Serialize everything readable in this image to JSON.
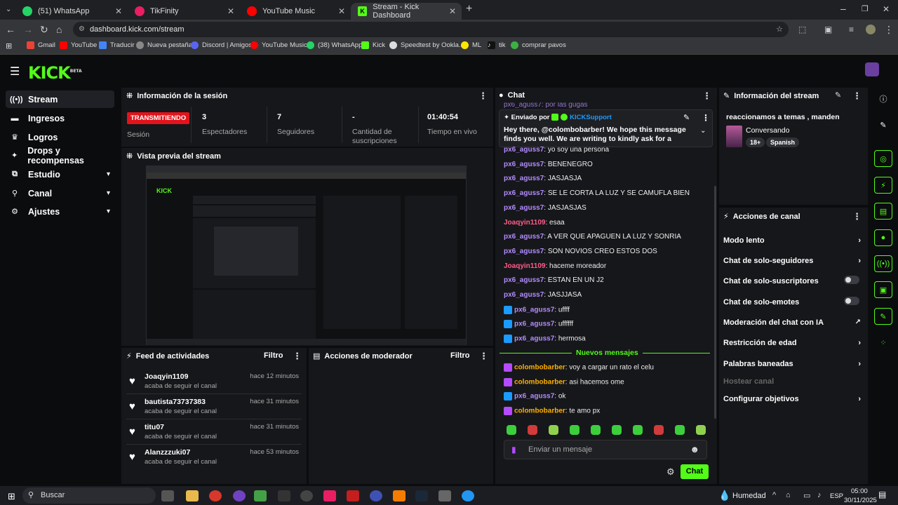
{
  "browser": {
    "tabs": [
      {
        "label": "(51) WhatsApp",
        "color": "#25d366"
      },
      {
        "label": "TikFinity",
        "color": "#e91e63"
      },
      {
        "label": "YouTube Music",
        "color": "#ff0000"
      },
      {
        "label": "Stream - Kick Dashboard",
        "color": "#53fc18"
      }
    ],
    "url": "dashboard.kick.com/stream",
    "bookmarks": [
      {
        "label": "Gmail",
        "color": "#ea4335"
      },
      {
        "label": "YouTube",
        "color": "#ff0000"
      },
      {
        "label": "Traducir",
        "color": "#4285f4"
      },
      {
        "label": "Nueva pestaña",
        "color": "#888"
      },
      {
        "label": "Discord | Amigos",
        "color": "#5865f2"
      },
      {
        "label": "YouTube Music",
        "color": "#ff0000"
      },
      {
        "label": "(38) WhatsApp",
        "color": "#25d366"
      },
      {
        "label": "Kick",
        "color": "#53fc18"
      },
      {
        "label": "Speedtest by Ookla...",
        "color": "#ddd"
      },
      {
        "label": "ML",
        "color": "#ffe600"
      },
      {
        "label": "tik",
        "color": "#fff"
      },
      {
        "label": "comprar pavos",
        "color": "#3cb043"
      }
    ]
  },
  "kick": {
    "logo": "KICK",
    "logo_sup": "BETA",
    "sidebar": [
      {
        "label": "Stream",
        "icon": "broadcast-icon",
        "chev": ""
      },
      {
        "label": "Ingresos",
        "icon": "money-icon",
        "chev": ""
      },
      {
        "label": "Logros",
        "icon": "trophy-icon",
        "chev": ""
      },
      {
        "label": "Drops y recompensas",
        "icon": "gift-icon",
        "chev": ""
      },
      {
        "label": "Estudio",
        "icon": "studio-icon",
        "chev": "▾"
      },
      {
        "label": "Canal",
        "icon": "channel-icon",
        "chev": "▾"
      },
      {
        "label": "Ajustes",
        "icon": "settings-icon",
        "chev": "▾"
      }
    ],
    "session": {
      "title": "Información de la sesión",
      "live_badge": "TRANSMITIENDO",
      "live_label": "Sesión",
      "stats": [
        {
          "value": "3",
          "label": "Espectadores"
        },
        {
          "value": "7",
          "label": "Seguidores"
        },
        {
          "value": "-",
          "label": "Cantidad de suscripciones"
        },
        {
          "value": "01:40:54",
          "label": "Tiempo en vivo"
        }
      ]
    },
    "preview_title": "Vista previa del stream",
    "feed": {
      "title": "Feed de actividades",
      "filter": "Filtro",
      "items": [
        {
          "user": "Joaqyin1109",
          "sub": "acaba de seguir el canal",
          "time": "hace 12 minutos"
        },
        {
          "user": "bautista73737383",
          "sub": "acaba de seguir el canal",
          "time": "hace 31 minutos"
        },
        {
          "user": "titu07",
          "sub": "acaba de seguir el canal",
          "time": "hace 31 minutos"
        },
        {
          "user": "Alanzzzuki07",
          "sub": "acaba de seguir el canal",
          "time": "hace 53 minutos"
        }
      ]
    },
    "mod": {
      "title": "Acciones de moderador",
      "filter": "Filtro"
    },
    "chat": {
      "title": "Chat",
      "cut_line": "px6_aguss7: por las gugas",
      "pinned_by": "Enviado por",
      "pinned_user": "KICKSupport",
      "pinned_text": "Hey there, @colombobarber! We hope this message finds you well. We are writing to kindly ask for a moment of you...",
      "messages": [
        {
          "user": "px6_aguss7",
          "text": "yo soy una persona",
          "color": "#b38cff",
          "badge": ""
        },
        {
          "user": "px6_aguss7",
          "text": "BENENEGRO",
          "color": "#b38cff",
          "badge": ""
        },
        {
          "user": "px6_aguss7",
          "text": "JASJASJA",
          "color": "#b38cff",
          "badge": ""
        },
        {
          "user": "px6_aguss7",
          "text": "SE LE CORTA LA LUZ Y SE CAMUFLA BIEN",
          "color": "#b38cff",
          "badge": ""
        },
        {
          "user": "px6_aguss7",
          "text": "JASJASJAS",
          "color": "#b38cff",
          "badge": ""
        },
        {
          "user": "Joaqyin1109",
          "text": "esaa",
          "color": "#ff5c8a",
          "badge": ""
        },
        {
          "user": "px6_aguss7",
          "text": "A VER QUE APAGUEN LA LUZ Y SONRIA",
          "color": "#b38cff",
          "badge": ""
        },
        {
          "user": "px6_aguss7",
          "text": "SON NOVIOS CREO ESTOS DOS",
          "color": "#b38cff",
          "badge": ""
        },
        {
          "user": "Joaqyin1109",
          "text": "haceme moreador",
          "color": "#ff5c8a",
          "badge": ""
        },
        {
          "user": "px6_aguss7",
          "text": "ESTAN EN UN J2",
          "color": "#b38cff",
          "badge": ""
        },
        {
          "user": "px6_aguss7",
          "text": "JASJJASA",
          "color": "#b38cff",
          "badge": ""
        },
        {
          "user": "px6_aguss7",
          "text": "uffff",
          "color": "#b38cff",
          "badge": "mod"
        },
        {
          "user": "px6_aguss7",
          "text": "uffffff",
          "color": "#b38cff",
          "badge": "mod"
        },
        {
          "user": "px6_aguss7",
          "text": "hermosa",
          "color": "#b38cff",
          "badge": "mod"
        }
      ],
      "new_label": "Nuevos mensajes",
      "new_messages": [
        {
          "user": "colombobarber",
          "text": "voy a cargar un rato el celu",
          "color": "#ffb000",
          "badge": "host"
        },
        {
          "user": "colombobarber",
          "text": "asi hacemos ome",
          "color": "#ffb000",
          "badge": "host"
        },
        {
          "user": "px6_aguss7",
          "text": "ok",
          "color": "#b38cff",
          "badge": "mod"
        },
        {
          "user": "colombobarber",
          "text": "te amo px",
          "color": "#ffb000",
          "badge": "host"
        }
      ],
      "placeholder": "Enviar un mensaje",
      "send": "Chat"
    },
    "stream_info": {
      "title": "Información del stream",
      "stream_title": "reaccionamos a temas , manden",
      "category": "Conversando",
      "tags": [
        "18+",
        "Spanish"
      ]
    },
    "actions": {
      "title": "Acciones de canal",
      "items": [
        {
          "label": "Modo lento",
          "ctrl": "arrow",
          "disabled": false
        },
        {
          "label": "Chat de solo-seguidores",
          "ctrl": "arrow",
          "disabled": false
        },
        {
          "label": "Chat de solo-suscriptores",
          "ctrl": "toggle",
          "disabled": false
        },
        {
          "label": "Chat de solo-emotes",
          "ctrl": "toggle",
          "disabled": false
        },
        {
          "label": "Moderación del chat con IA",
          "ctrl": "ext",
          "disabled": false
        },
        {
          "label": "Restricción de edad",
          "ctrl": "arrow",
          "disabled": false
        },
        {
          "label": "Palabras baneadas",
          "ctrl": "arrow",
          "disabled": false
        },
        {
          "label": "Hostear canal",
          "ctrl": "",
          "disabled": true
        },
        {
          "label": "Configurar objetivos",
          "ctrl": "arrow",
          "disabled": false
        }
      ]
    }
  },
  "taskbar": {
    "search": "Buscar",
    "weather": "Humedad",
    "lang": "ESP",
    "time": "05:00",
    "date": "30/11/2025"
  }
}
